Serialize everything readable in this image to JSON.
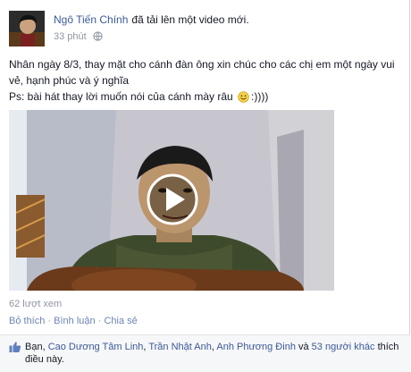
{
  "post": {
    "author": "Ngô Tiến Chính",
    "action": "đã tải lên một video mới.",
    "time": "33 phút",
    "text_line1": "Nhân ngày 8/3, thay mặt cho cánh đàn ông xin chúc cho các chị em một ngày vui vẻ, hạnh phúc và ý nghĩa",
    "text_line2_before": "Ps: bài hát thay lời muốn nói của cánh mày râu",
    "text_line2_after": ":))))"
  },
  "video": {
    "views": "62 lượt xem"
  },
  "actions": {
    "like": "Bỏ thích",
    "comment": "Bình luận",
    "share": "Chia sẻ",
    "separator": "·"
  },
  "likes": {
    "prefix": "Bạn, ",
    "names": [
      "Cao Dương Tâm Linh",
      "Trần Nhật Anh",
      "Anh Phương Đinh"
    ],
    "conj": " và ",
    "others": "53 người khác",
    "suffix": " thích điều này."
  },
  "colors": {
    "link": "#3b5998",
    "muted": "#9197a3",
    "footer_bg": "#f6f7f8"
  }
}
